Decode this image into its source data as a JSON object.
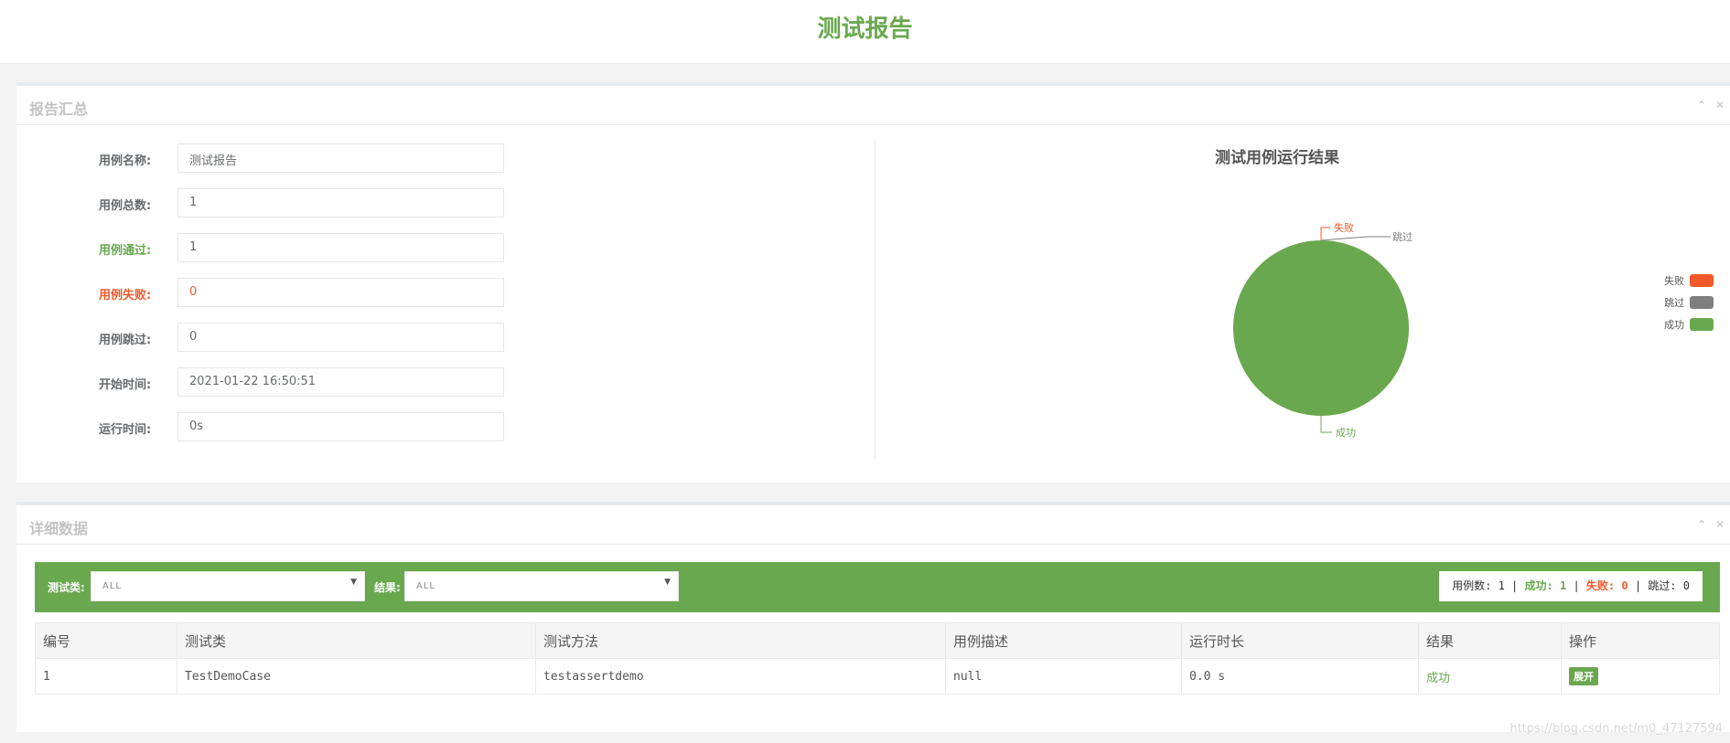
{
  "header": {
    "title": "测试报告"
  },
  "summary": {
    "panel_title": "报告汇总",
    "fields": [
      {
        "label": "用例名称:",
        "value": "测试报告"
      },
      {
        "label": "用例总数:",
        "value": "1"
      },
      {
        "label": "用例通过:",
        "value": "1"
      },
      {
        "label": "用例失败:",
        "value": "0"
      },
      {
        "label": "用例跳过:",
        "value": "0"
      },
      {
        "label": "开始时间:",
        "value": "2021-01-22 16:50:51"
      },
      {
        "label": "运行时间:",
        "value": "0s"
      }
    ]
  },
  "chart_data": {
    "type": "pie",
    "title": "测试用例运行结果",
    "slices": [
      {
        "name": "失败",
        "value": 0,
        "color": "#f05a2a"
      },
      {
        "name": "跳过",
        "value": 0,
        "color": "#7f7f7f"
      },
      {
        "name": "成功",
        "value": 1,
        "color": "#6aa84f"
      }
    ],
    "legend_position": "right"
  },
  "detail": {
    "panel_title": "详细数据",
    "filters": {
      "class_label": "测试类:",
      "class_value": "ALL",
      "result_label": "结果:",
      "result_value": "ALL"
    },
    "stats": {
      "total_label": "用例数:",
      "total": "1",
      "success_label": "成功:",
      "success": "1",
      "fail_label": "失败:",
      "fail": "0",
      "skip_label": "跳过:",
      "skip": "0"
    },
    "columns": [
      "编号",
      "测试类",
      "测试方法",
      "用例描述",
      "运行时长",
      "结果",
      "操作"
    ],
    "rows": [
      {
        "id": "1",
        "class": "TestDemoCase",
        "method": "testassertdemo",
        "desc": "null",
        "duration": "0.0 s",
        "result": "成功",
        "action": "展开"
      }
    ]
  },
  "watermark": "https://blog.csdn.net/m0_47127594",
  "colors": {
    "accent": "#6aa84f",
    "fail": "#f05a2a",
    "skip": "#7f7f7f"
  }
}
